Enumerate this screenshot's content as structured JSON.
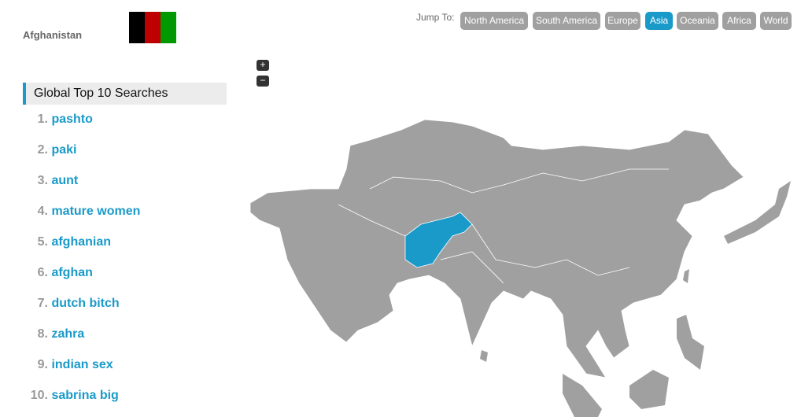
{
  "country": "Afghanistan",
  "flag": {
    "colors": [
      "#000000",
      "#be0000",
      "#009900"
    ]
  },
  "jump": {
    "label": "Jump To:",
    "regions": [
      {
        "label": "North America",
        "active": false
      },
      {
        "label": "South America",
        "active": false
      },
      {
        "label": "Europe",
        "active": false
      },
      {
        "label": "Asia",
        "active": true
      },
      {
        "label": "Oceania",
        "active": false
      },
      {
        "label": "Africa",
        "active": false
      },
      {
        "label": "World",
        "active": false
      }
    ]
  },
  "zoom": {
    "in": "+",
    "out": "−"
  },
  "panel": {
    "title": "Global Top 10 Searches",
    "items": [
      {
        "n": "1.",
        "t": "pashto"
      },
      {
        "n": "2.",
        "t": "paki"
      },
      {
        "n": "3.",
        "t": "aunt"
      },
      {
        "n": "4.",
        "t": "mature women"
      },
      {
        "n": "5.",
        "t": "afghanian"
      },
      {
        "n": "6.",
        "t": "afghan"
      },
      {
        "n": "7.",
        "t": "dutch bitch"
      },
      {
        "n": "8.",
        "t": "zahra"
      },
      {
        "n": "9.",
        "t": "indian sex"
      },
      {
        "n": "10.",
        "t": "sabrina big"
      }
    ]
  },
  "map": {
    "land_color": "#a0a0a0",
    "highlight_color": "#1a9ac9",
    "highlighted": "Afghanistan"
  }
}
